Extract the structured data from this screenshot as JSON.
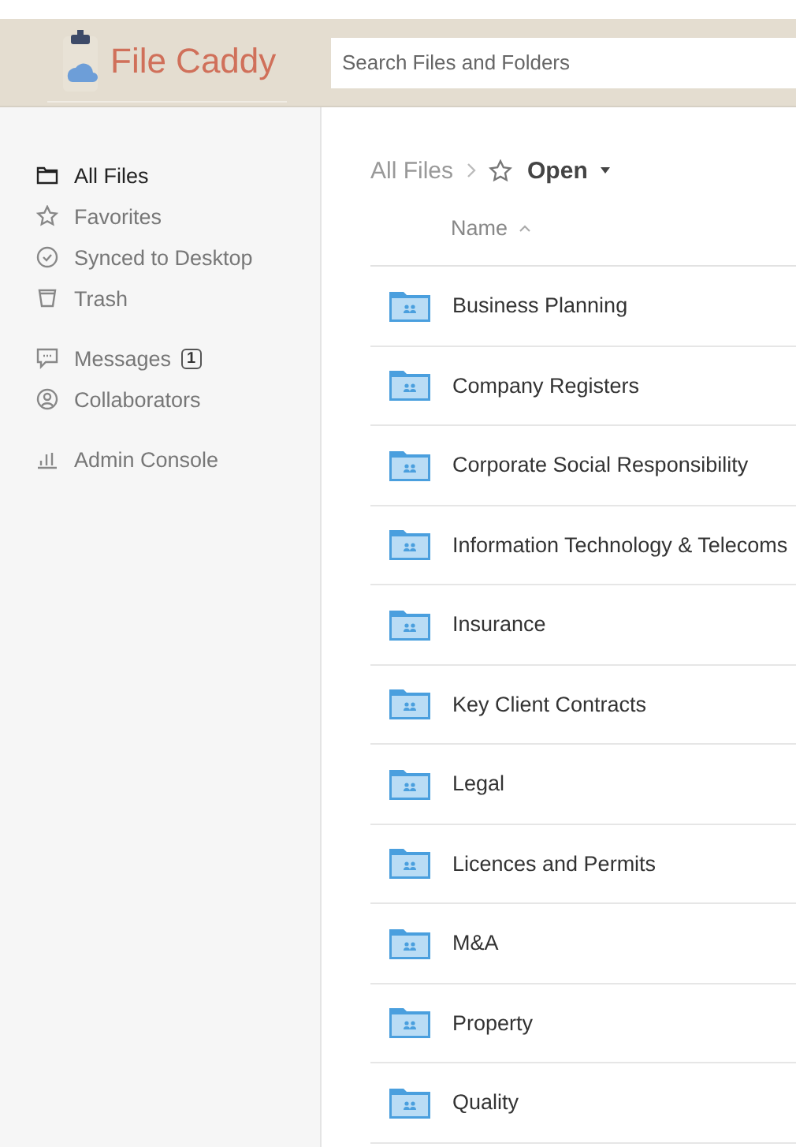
{
  "header": {
    "app_name": "File Caddy",
    "search": {
      "placeholder": "Search Files and Folders"
    }
  },
  "sidebar": {
    "groups": [
      [
        {
          "label": "All Files",
          "selected": true
        },
        {
          "label": "Favorites",
          "selected": false
        },
        {
          "label": "Synced to Desktop",
          "selected": false
        },
        {
          "label": "Trash",
          "selected": false
        }
      ],
      [
        {
          "label": "Messages",
          "selected": false,
          "badge": "1"
        },
        {
          "label": "Collaborators",
          "selected": false
        }
      ],
      [
        {
          "label": "Admin Console",
          "selected": false
        }
      ]
    ]
  },
  "breadcrumb": {
    "parent": "All Files",
    "current": "Open"
  },
  "table": {
    "columns": [
      "Name"
    ],
    "rows": [
      {
        "name": "Business Planning"
      },
      {
        "name": "Company Registers"
      },
      {
        "name": "Corporate Social Responsibility"
      },
      {
        "name": "Information Technology & Telecoms"
      },
      {
        "name": "Insurance"
      },
      {
        "name": "Key Client Contracts"
      },
      {
        "name": "Legal"
      },
      {
        "name": "Licences and Permits"
      },
      {
        "name": "M&A"
      },
      {
        "name": "Property"
      },
      {
        "name": "Quality"
      }
    ]
  }
}
